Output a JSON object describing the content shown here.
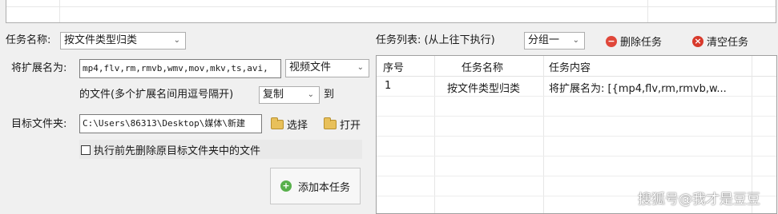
{
  "top_panel": {},
  "task_name": {
    "label": "任务名称:",
    "value": "按文件类型归类"
  },
  "task_list": {
    "label": "任务列表: (从上往下执行)",
    "group_value": "分组一",
    "delete_label": "删除任务",
    "clear_label": "清空任务",
    "columns": [
      "序号",
      "任务名称",
      "任务内容"
    ],
    "rows": [
      {
        "index": "1",
        "name": "按文件类型归类",
        "content": "将扩展名为: [{mp4,flv,rm,rmvb,w..."
      }
    ]
  },
  "extension": {
    "label": "将扩展名为:",
    "value": "mp4,flv,rm,rmvb,wmv,mov,mkv,ts,avi,",
    "type_value": "视频文件"
  },
  "files_row": {
    "text": "的文件(多个扩展名间用逗号隔开)",
    "action_value": "复制",
    "to_label": "到"
  },
  "target": {
    "label": "目标文件夹:",
    "value": "C:\\Users\\86313\\Desktop\\媒体\\新建",
    "select_label": "选择",
    "open_label": "打开"
  },
  "delete_before": {
    "label": "执行前先删除原目标文件夹中的文件",
    "checked": false
  },
  "add_task": {
    "label": "添加本任务"
  },
  "watermark": "搜狐号@我才是豆豆",
  "colors": {
    "delete_icon": "#e0473a",
    "clear_icon": "#d83a2c",
    "add_icon": "#58b04c"
  }
}
